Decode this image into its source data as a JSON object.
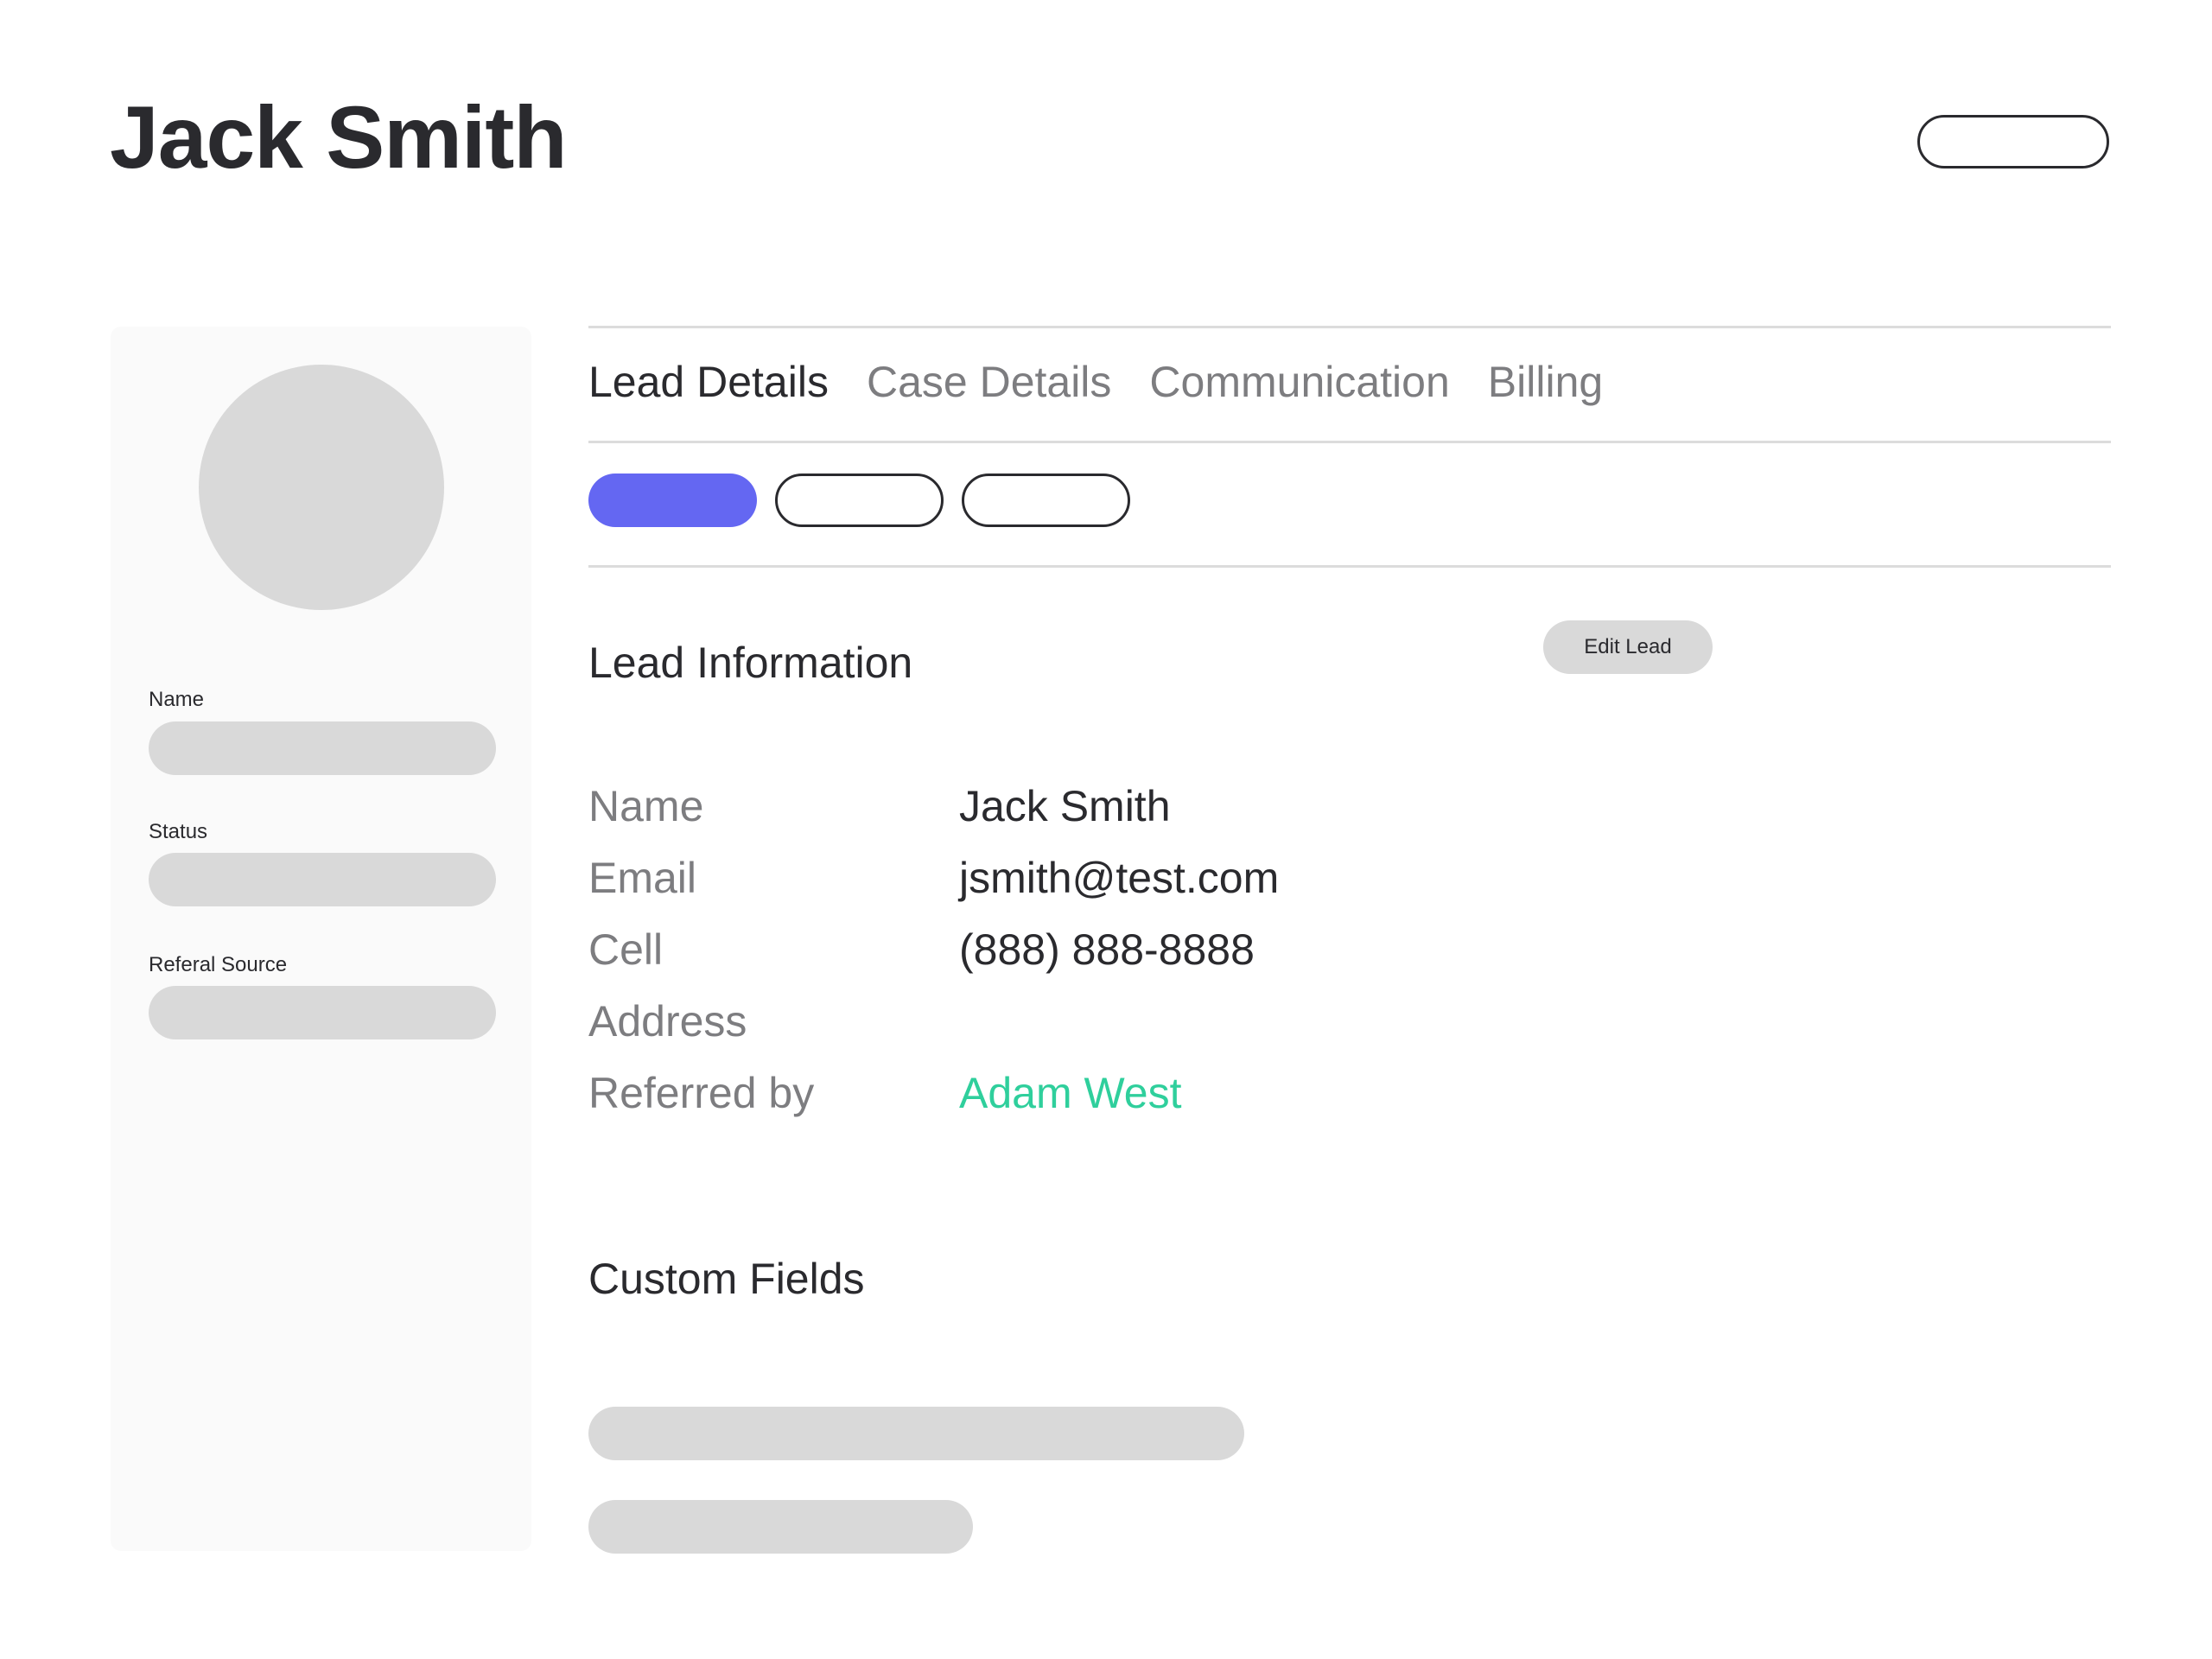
{
  "header": {
    "title": "Jack Smith"
  },
  "sidebar": {
    "fields": [
      {
        "label": "Name",
        "value": ""
      },
      {
        "label": "Status",
        "value": ""
      },
      {
        "label": "Referal Source",
        "value": ""
      }
    ]
  },
  "tabs": [
    {
      "label": "Lead Details",
      "active": true
    },
    {
      "label": "Case Details",
      "active": false
    },
    {
      "label": "Communication",
      "active": false
    },
    {
      "label": "Billing",
      "active": false
    }
  ],
  "lead_info": {
    "title": "Lead Information",
    "edit_label": "Edit Lead",
    "rows": [
      {
        "label": "Name",
        "value": "Jack Smith"
      },
      {
        "label": "Email",
        "value": "jsmith@test.com"
      },
      {
        "label": "Cell",
        "value": "(888) 888-8888"
      },
      {
        "label": "Address",
        "value": ""
      },
      {
        "label": "Referred by",
        "value": "Adam West"
      }
    ]
  },
  "custom_fields": {
    "title": "Custom Fields"
  },
  "colors": {
    "accent": "#6467f2",
    "link": "#2fcf9c",
    "placeholder": "#d9d9d9",
    "text": "#2a2a2e",
    "muted": "#7d7d80"
  }
}
